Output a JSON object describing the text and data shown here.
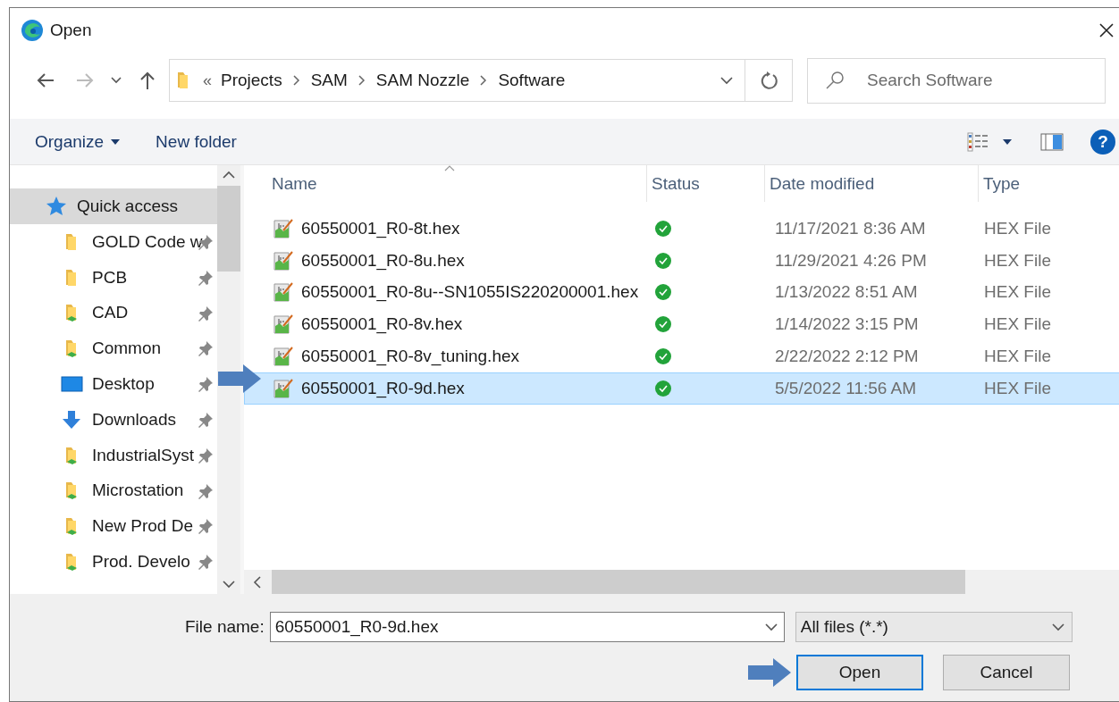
{
  "window": {
    "title": "Open"
  },
  "nav": {
    "breadcrumb_overflow": "«",
    "path": [
      "Projects",
      "SAM",
      "SAM Nozzle",
      "Software"
    ],
    "search": {
      "placeholder": "Search Software"
    }
  },
  "toolbar": {
    "organize": "Organize",
    "new_folder": "New folder",
    "help": "?"
  },
  "sidebar": {
    "items": [
      {
        "kind": "quick",
        "label": "Quick access",
        "pinned": false,
        "selected": true
      },
      {
        "kind": "folder",
        "label": "GOLD Code w",
        "pinned": true,
        "selected": false
      },
      {
        "kind": "folder",
        "label": "PCB",
        "pinned": true,
        "selected": false
      },
      {
        "kind": "network",
        "label": "CAD",
        "pinned": true,
        "selected": false
      },
      {
        "kind": "network",
        "label": "Common",
        "pinned": true,
        "selected": false
      },
      {
        "kind": "desktop",
        "label": "Desktop",
        "pinned": true,
        "selected": false
      },
      {
        "kind": "downloads",
        "label": "Downloads",
        "pinned": true,
        "selected": false
      },
      {
        "kind": "network",
        "label": "IndustrialSyst",
        "pinned": true,
        "selected": false
      },
      {
        "kind": "network",
        "label": "Microstation",
        "pinned": true,
        "selected": false
      },
      {
        "kind": "network",
        "label": "New Prod De",
        "pinned": true,
        "selected": false
      },
      {
        "kind": "network",
        "label": "Prod. Develo",
        "pinned": true,
        "selected": false
      }
    ]
  },
  "table": {
    "columns": [
      "Name",
      "Status",
      "Date modified",
      "Type"
    ],
    "rows": [
      {
        "name": "60550001_R0-8t.hex",
        "synced": true,
        "date": "11/17/2021 8:36 AM",
        "type": "HEX File",
        "selected": false
      },
      {
        "name": "60550001_R0-8u.hex",
        "synced": true,
        "date": "11/29/2021 4:26 PM",
        "type": "HEX File",
        "selected": false
      },
      {
        "name": "60550001_R0-8u--SN1055IS220200001.hex",
        "synced": true,
        "date": "1/13/2022 8:51 AM",
        "type": "HEX File",
        "selected": false
      },
      {
        "name": "60550001_R0-8v.hex",
        "synced": true,
        "date": "1/14/2022 3:15 PM",
        "type": "HEX File",
        "selected": false
      },
      {
        "name": "60550001_R0-8v_tuning.hex",
        "synced": true,
        "date": "2/22/2022 2:12 PM",
        "type": "HEX File",
        "selected": false
      },
      {
        "name": "60550001_R0-9d.hex",
        "synced": true,
        "date": "5/5/2022 11:56 AM",
        "type": "HEX File",
        "selected": true
      }
    ]
  },
  "footer": {
    "file_name_label": "File name:",
    "file_name": "60550001_R0-9d.hex",
    "filter": "All files (*.*)",
    "buttons": [
      {
        "label": "Open",
        "default": true
      },
      {
        "label": "Cancel",
        "default": false
      }
    ]
  }
}
